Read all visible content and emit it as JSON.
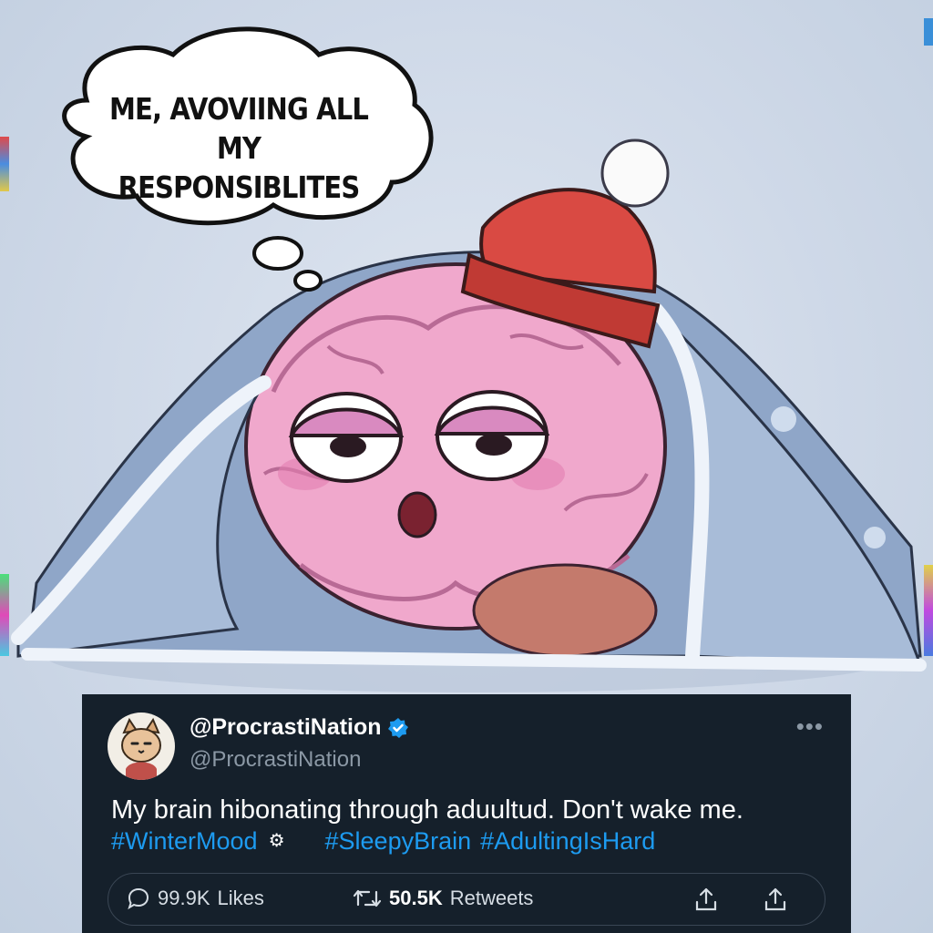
{
  "thought_bubble": {
    "line1": "ME, AVOVIING ALL",
    "line2": "MY RESPONSIBLITES"
  },
  "tweet": {
    "display_name": "@ProcrastiNation",
    "handle": "@ProcrastiNation",
    "verified": true,
    "text": "My brain hibonating through aduultud. Don't wake me.",
    "hashtags": [
      "#WinterMood",
      "#SleepyBrain",
      "#AdultingIsHard"
    ],
    "more_label": "•••",
    "likes_count": "99.9K",
    "likes_label": "Likes",
    "retweets_count": "50.5K",
    "retweets_label": "Retweets",
    "icons": [
      "cat-avatar",
      "verified-badge-icon",
      "gear-icon",
      "comment-icon",
      "retweet-icon",
      "share-icon",
      "upload-icon"
    ]
  },
  "colors": {
    "background": "#cfd9e8",
    "tweet_bg": "#15202b",
    "link": "#1d9bf0",
    "muted": "#8b98a5",
    "brain_pink": "#f2a9cf",
    "hat_red": "#d94a43"
  }
}
